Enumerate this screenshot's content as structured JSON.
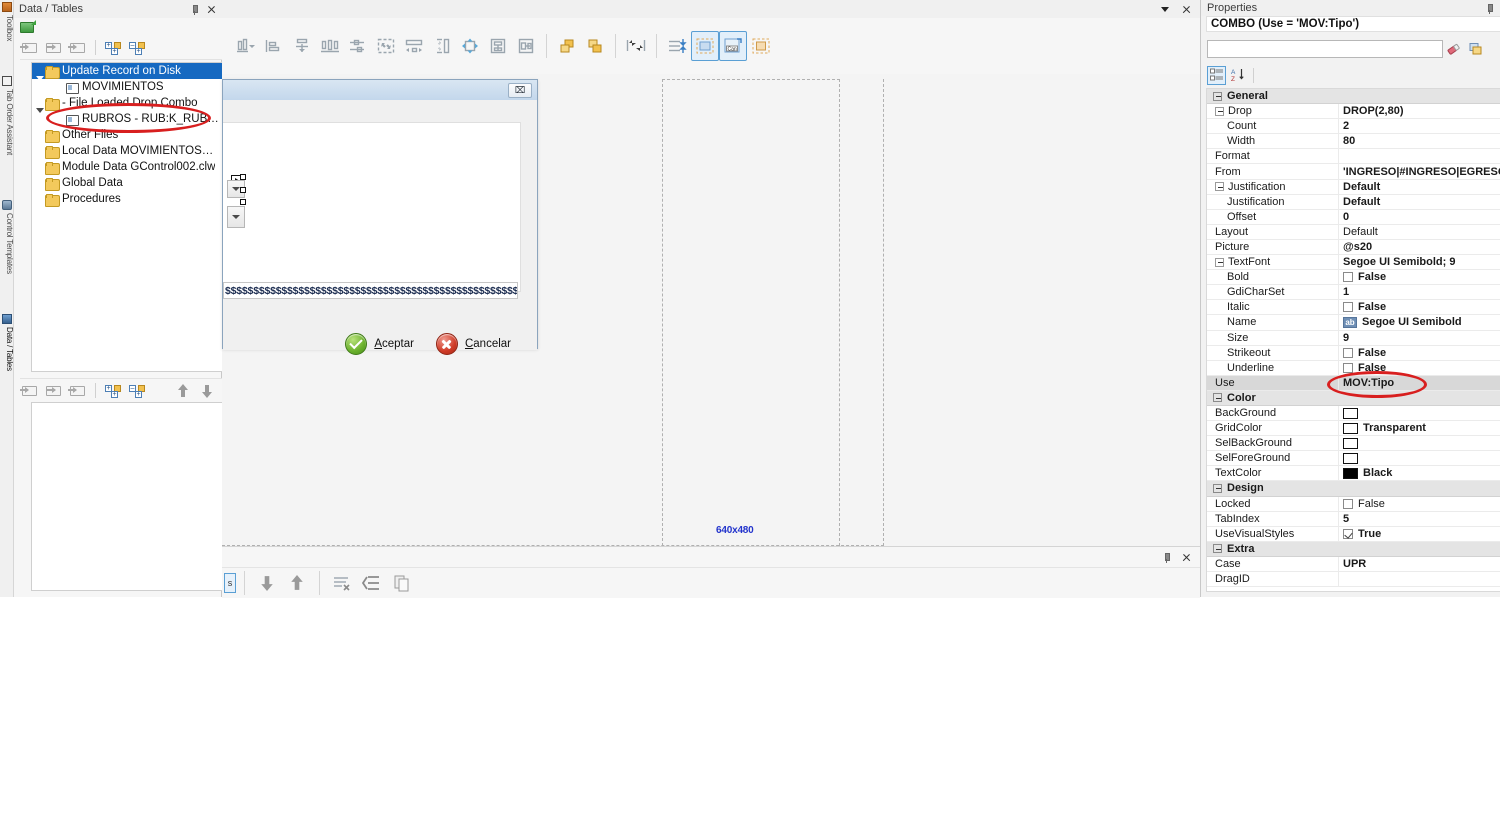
{
  "left_tabs": [
    {
      "label": "Toolbox",
      "icon": "toolbox-icon"
    },
    {
      "label": "Tab Order Assistant",
      "icon": "tab-order-icon"
    },
    {
      "label": "Control Templates",
      "icon": "control-templates-icon"
    },
    {
      "label": "Data / Tables",
      "icon": "data-tables-icon"
    }
  ],
  "data_tables": {
    "title": "Data / Tables",
    "pin_icon": "pin-icon",
    "close_icon": "close-icon",
    "refresh_icon": "refresh-green-icon",
    "toolbar": [
      {
        "name": "insert-field-button",
        "icon": "insert-field-icon"
      },
      {
        "name": "edit-field-button",
        "icon": "edit-field-icon"
      },
      {
        "name": "delete-field-button",
        "icon": "delete-field-icon"
      },
      {
        "name": "expand-all-button",
        "icon": "expand-all-icon"
      },
      {
        "name": "collapse-all-button",
        "icon": "collapse-all-icon"
      }
    ],
    "bottom_toolbar": [
      {
        "name": "insert-field-button",
        "icon": "insert-field-icon"
      },
      {
        "name": "edit-field-button",
        "icon": "edit-field-icon"
      },
      {
        "name": "delete-field-button",
        "icon": "delete-field-icon"
      },
      {
        "name": "expand-all-button",
        "icon": "expand-all-icon"
      },
      {
        "name": "collapse-all-button",
        "icon": "collapse-all-icon"
      },
      {
        "name": "move-up-button",
        "icon": "arrow-up-icon"
      },
      {
        "name": "move-down-button",
        "icon": "arrow-down-icon"
      }
    ],
    "tree": [
      {
        "label": "Update Record on Disk",
        "icon": "folder-icon",
        "indent": 0,
        "expander": "open",
        "selected": true
      },
      {
        "label": "MOVIMIENTOS",
        "icon": "file-icon",
        "indent": 1,
        "expander": "none",
        "selected": false
      },
      {
        "label": "- File Loaded Drop Combo",
        "icon": "folder-icon",
        "indent": 0,
        "expander": "open",
        "selected": false
      },
      {
        "label": "RUBROS - RUB:K_RUB_Nombre",
        "icon": "file-icon",
        "indent": 1,
        "expander": "none",
        "selected": false
      },
      {
        "label": "Other Files",
        "icon": "folder-icon",
        "indent": 0,
        "expander": "none",
        "selected": false
      },
      {
        "label": "Local Data MOVIMIENTOSABM",
        "icon": "folder-icon",
        "indent": 0,
        "expander": "none",
        "selected": false
      },
      {
        "label": "Module Data GControl002.clw",
        "icon": "folder-icon",
        "indent": 0,
        "expander": "none",
        "selected": false
      },
      {
        "label": "Global Data",
        "icon": "folder-icon",
        "indent": 0,
        "expander": "none",
        "selected": false
      },
      {
        "label": "Procedures",
        "icon": "folder-icon",
        "indent": 0,
        "expander": "none",
        "selected": false
      }
    ]
  },
  "document": {
    "chevron_icon": "chevron-down-icon",
    "close_icon": "close-icon",
    "align_toolbar": [
      {
        "name": "align-bottom-button",
        "icon": "align-bottom-icon"
      },
      {
        "name": "align-left-button",
        "icon": "align-left-icon"
      },
      {
        "name": "center-vertical-button",
        "icon": "center-vertical-icon"
      },
      {
        "name": "distribute-horizontal-button",
        "icon": "distribute-horizontal-icon"
      },
      {
        "name": "align-center-button",
        "icon": "align-center-icon"
      },
      {
        "name": "size-to-fit-button",
        "icon": "size-to-fit-icon"
      },
      {
        "name": "space-horizontal-button",
        "icon": "space-horizontal-icon"
      },
      {
        "name": "space-vertical-button",
        "icon": "space-vertical-icon"
      },
      {
        "name": "center-in-window-button",
        "icon": "center-in-window-icon"
      },
      {
        "name": "split-horizontal-button",
        "icon": "split-horizontal-icon"
      },
      {
        "name": "split-vertical-button",
        "icon": "split-vertical-icon"
      },
      {
        "name": "bring-to-front-button",
        "icon": "bring-to-front-icon"
      },
      {
        "name": "send-to-back-button",
        "icon": "send-to-back-icon"
      },
      {
        "name": "tab-order-button",
        "icon": "tab-order-icon"
      },
      {
        "name": "reorder-button",
        "icon": "reorder-icon"
      },
      {
        "name": "show-grid-button",
        "icon": "show-grid-icon"
      },
      {
        "name": "canvas-preview-button",
        "icon": "canvas-preview-icon"
      },
      {
        "name": "duplicate-button",
        "icon": "duplicate-icon"
      }
    ],
    "canvas": {
      "size_label": "640x480",
      "form": {
        "close_button": "⌧",
        "entry_value": "$$$$$$$$$$$$$$$$$$$$$$$$$$$$$$$$$$$$$$$$$$$$$$$$$$$$$$$$$$$$$$$$$$$",
        "accept_button": {
          "label_pre": "A",
          "label_rest": "ceptar",
          "icon": "check-circle-icon"
        },
        "cancel_button": {
          "label_pre": "C",
          "label_rest": "ancelar",
          "icon": "x-circle-icon"
        }
      }
    },
    "bottom_panel": {
      "pin_icon": "pin-icon",
      "close_icon": "close-icon",
      "chip_label": "s",
      "toolbar": [
        {
          "name": "move-down-button",
          "icon": "arrow-down-icon"
        },
        {
          "name": "move-up-button",
          "icon": "arrow-up-icon"
        },
        {
          "name": "delete-line-button",
          "icon": "delete-line-icon"
        },
        {
          "name": "indent-button",
          "icon": "indent-icon"
        },
        {
          "name": "copy-button",
          "icon": "copy-icon"
        }
      ]
    }
  },
  "properties": {
    "title": "Properties",
    "pin_icon": "pin-icon",
    "object_name": "COMBO (Use = 'MOV:Tipo')",
    "search_value": "",
    "search_placeholder": "",
    "eraser_icon": "eraser-icon",
    "property-list_icon": "property-list-icon",
    "categorized_icon": "categorized-view-icon",
    "alphabetical_icon": "alphabetical-sort-icon",
    "rows": [
      {
        "kind": "category",
        "name": "General"
      },
      {
        "kind": "prop",
        "name": "Drop",
        "value": "DROP(2,80)",
        "indent": 1,
        "expander": true,
        "bold": true
      },
      {
        "kind": "prop",
        "name": "Count",
        "value": "2",
        "indent": 2,
        "bold": true
      },
      {
        "kind": "prop",
        "name": "Width",
        "value": "80",
        "indent": 2,
        "bold": true
      },
      {
        "kind": "prop",
        "name": "Format",
        "value": "",
        "indent": 1
      },
      {
        "kind": "prop",
        "name": "From",
        "value": "'INGRESO|#INGRESO|EGRESO|#..",
        "indent": 1,
        "bold": true
      },
      {
        "kind": "prop",
        "name": "Justification",
        "value": "Default",
        "indent": 1,
        "expander": true,
        "bold": true
      },
      {
        "kind": "prop",
        "name": "Justification",
        "value": "Default",
        "indent": 2,
        "bold": true
      },
      {
        "kind": "prop",
        "name": "Offset",
        "value": "0",
        "indent": 2,
        "bold": true
      },
      {
        "kind": "prop",
        "name": "Layout",
        "value": "Default",
        "indent": 1
      },
      {
        "kind": "prop",
        "name": "Picture",
        "value": "@s20",
        "indent": 1,
        "bold": true
      },
      {
        "kind": "prop",
        "name": "TextFont",
        "value": "Segoe UI Semibold; 9",
        "indent": 1,
        "expander": true,
        "bold": true
      },
      {
        "kind": "prop",
        "name": "Bold",
        "value": "False",
        "indent": 2,
        "checkbox": "off",
        "bold": true
      },
      {
        "kind": "prop",
        "name": "GdiCharSet",
        "value": "1",
        "indent": 2,
        "bold": true
      },
      {
        "kind": "prop",
        "name": "Italic",
        "value": "False",
        "indent": 2,
        "checkbox": "off",
        "bold": true
      },
      {
        "kind": "prop",
        "name": "Name",
        "value": "Segoe UI Semibold",
        "indent": 2,
        "abicon": "ab",
        "bold": true
      },
      {
        "kind": "prop",
        "name": "Size",
        "value": "9",
        "indent": 2,
        "bold": true
      },
      {
        "kind": "prop",
        "name": "Strikeout",
        "value": "False",
        "indent": 2,
        "checkbox": "off",
        "bold": true
      },
      {
        "kind": "prop",
        "name": "Underline",
        "value": "False",
        "indent": 2,
        "checkbox": "off",
        "bold": true
      },
      {
        "kind": "prop",
        "name": "Use",
        "value": "MOV:Tipo",
        "indent": 1,
        "bold": true,
        "selected": true
      },
      {
        "kind": "category",
        "name": "Color"
      },
      {
        "kind": "prop",
        "name": "BackGround",
        "value": "",
        "indent": 1,
        "swatch": "#ffffff"
      },
      {
        "kind": "prop",
        "name": "GridColor",
        "value": "Transparent",
        "indent": 1,
        "swatch": "#ffffff",
        "bold": true
      },
      {
        "kind": "prop",
        "name": "SelBackGround",
        "value": "",
        "indent": 1,
        "swatch": "#ffffff"
      },
      {
        "kind": "prop",
        "name": "SelForeGround",
        "value": "",
        "indent": 1,
        "swatch": "#ffffff"
      },
      {
        "kind": "prop",
        "name": "TextColor",
        "value": "Black",
        "indent": 1,
        "swatch": "#000000",
        "bold": true
      },
      {
        "kind": "category",
        "name": "Design"
      },
      {
        "kind": "prop",
        "name": "Locked",
        "value": "False",
        "indent": 1,
        "checkbox": "off"
      },
      {
        "kind": "prop",
        "name": "TabIndex",
        "value": "5",
        "indent": 1,
        "bold": true
      },
      {
        "kind": "prop",
        "name": "UseVisualStyles",
        "value": "True",
        "indent": 1,
        "checkbox": "on",
        "bold": true
      },
      {
        "kind": "category",
        "name": "Extra"
      },
      {
        "kind": "prop",
        "name": "Case",
        "value": "UPR",
        "indent": 1,
        "bold": true
      },
      {
        "kind": "prop",
        "name": "DragID",
        "value": "",
        "indent": 1
      }
    ]
  },
  "annotations": {
    "accent_color": "#d81f1f",
    "highlight_tree_item": "RUBROS - RUB:K_RUB_Nombre",
    "highlight_property": "MOV:Tipo"
  }
}
